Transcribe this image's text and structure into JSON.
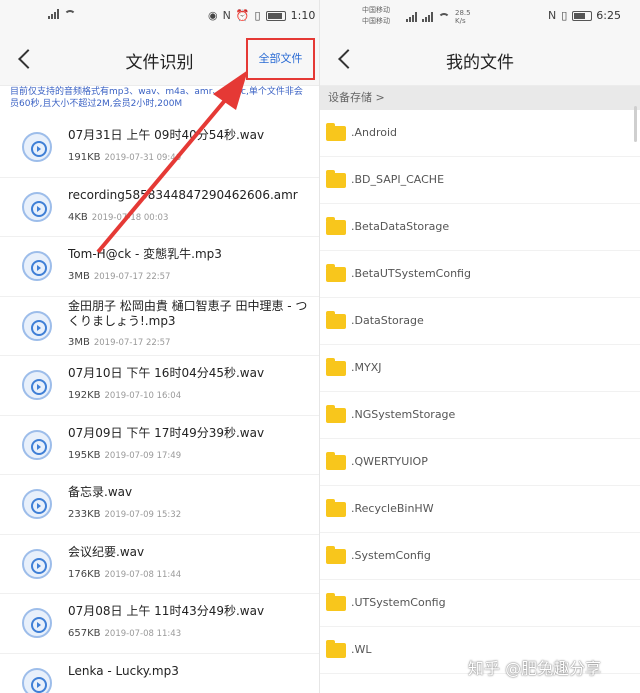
{
  "left": {
    "status": {
      "time": "1:10"
    },
    "title": "文件识别",
    "all_files_button": "全部文件",
    "notice": "目前仅支持的音频格式有mp3、wav、m4a、amr、...aac,单个文件非会员60秒,且大小不超过2M,会员2小时,200M",
    "files": [
      {
        "name": "07月31日 上午 09时40分54秒.wav",
        "size": "191KB",
        "date": "2019-07-31 09:40"
      },
      {
        "name": "recording5858344847290462606.amr",
        "size": "4KB",
        "date": "2019-07-18 00:03"
      },
      {
        "name": "Tom-H@ck - 変態乳牛.mp3",
        "size": "3MB",
        "date": "2019-07-17 22:57"
      },
      {
        "name": "金田朋子 松岡由貴 樋口智恵子 田中理恵 - つくりましょう!.mp3",
        "size": "3MB",
        "date": "2019-07-17 22:57"
      },
      {
        "name": "07月10日 下午 16时04分45秒.wav",
        "size": "192KB",
        "date": "2019-07-10 16:04"
      },
      {
        "name": "07月09日 下午 17时49分39秒.wav",
        "size": "195KB",
        "date": "2019-07-09 17:49"
      },
      {
        "name": "备忘录.wav",
        "size": "233KB",
        "date": "2019-07-09 15:32"
      },
      {
        "name": "会议纪要.wav",
        "size": "176KB",
        "date": "2019-07-08 11:44"
      },
      {
        "name": "07月08日 上午 11时43分49秒.wav",
        "size": "657KB",
        "date": "2019-07-08 11:43"
      },
      {
        "name": "Lenka - Lucky.mp3",
        "size": "",
        "date": ""
      }
    ]
  },
  "right": {
    "status": {
      "carrier1": "中国移动",
      "carrier2": "中国移动",
      "speed": "28.5 K/s",
      "battery": "82",
      "time": "6:25"
    },
    "title": "我的文件",
    "storage_label": "设备存储 >",
    "folders": [
      ".Android",
      ".BD_SAPI_CACHE",
      ".BetaDataStorage",
      ".BetaUTSystemConfig",
      ".DataStorage",
      ".MYXJ",
      ".NGSystemStorage",
      ".QWERTYUIOP",
      ".RecycleBinHW",
      ".SystemConfig",
      ".UTSystemConfig",
      ".WL"
    ]
  },
  "watermark": "知乎 @肥兔趣分享",
  "colors": {
    "annotation_red": "#e53935",
    "link_blue": "#2a6bd4",
    "folder_yellow": "#f8c61c"
  }
}
